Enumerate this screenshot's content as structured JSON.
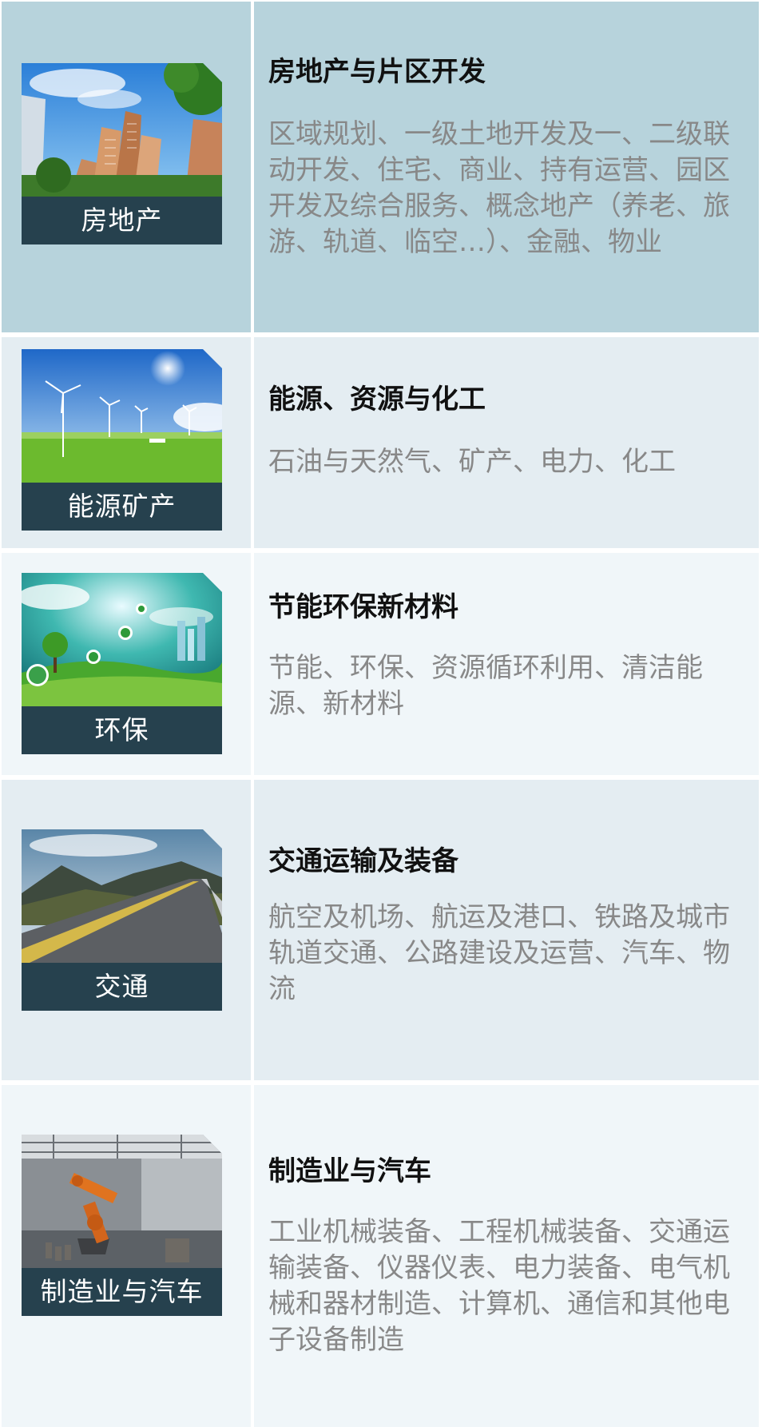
{
  "colors": {
    "row_1_bg": "#b7d3dc",
    "row_even_bg": "#e4edf2",
    "row_odd_bg": "#f0f6f9",
    "caption_bg": "#26414e",
    "title_text": "#111111",
    "desc_text": "#888888"
  },
  "sectors": [
    {
      "image": "residential-highrise-buildings-image",
      "caption": "房地产",
      "title": "房地产与片区开发",
      "description": "区域规划、一级土地开发及一、二级联动开发、住宅、商业、持有运营、园区开发及综合服务、概念地产（养老、旅游、轨道、临空…）、金融、物业"
    },
    {
      "image": "wind-turbines-grassland-image",
      "caption": "能源矿产",
      "title": "能源、资源与化工",
      "description": "石油与天然气、矿产、电力、化工"
    },
    {
      "image": "green-eco-city-image",
      "caption": "环保",
      "title": "节能环保新材料",
      "description": "节能、环保、资源循环利用、清洁能源、新材料"
    },
    {
      "image": "mountain-highway-image",
      "caption": "交通",
      "title": "交通运输及装备",
      "description": "航空及机场、航运及港口、铁路及城市轨道交通、公路建设及运营、汽车、物流"
    },
    {
      "image": "industrial-robot-arm-image",
      "caption": "制造业与汽车",
      "title": "制造业与汽车",
      "description": "工业机械装备、工程机械装备、交通运输装备、仪器仪表、电力装备、电气机械和器材制造、计算机、通信和其他电子设备制造"
    }
  ]
}
